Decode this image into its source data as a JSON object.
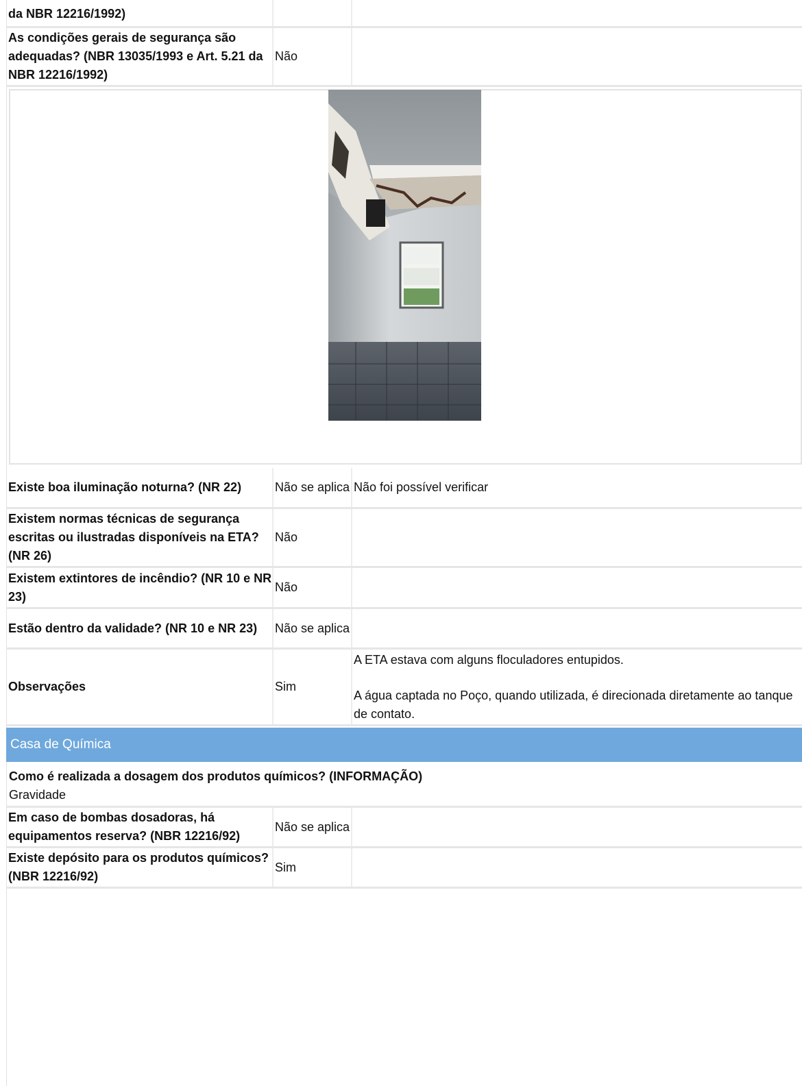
{
  "rows_top": [
    {
      "question": "da NBR 12216/1992)",
      "answer": "",
      "note": ""
    },
    {
      "question": "As condições gerais de segurança são adequadas? (NBR 13035/1993 e Art. 5.21 da NBR 12216/1992)",
      "answer": "Não",
      "note": ""
    }
  ],
  "rows_bottom": [
    {
      "question": "Existe boa iluminação noturna? (NR 22)",
      "answer": "Não se aplica",
      "note": "Não foi possível verificar"
    },
    {
      "question": "Existem normas técnicas de segurança escritas ou ilustradas disponíveis na ETA? (NR 26)",
      "answer": "Não",
      "note": ""
    },
    {
      "question": "Existem extintores de incêndio? (NR 10 e NR 23)",
      "answer": "Não",
      "note": ""
    },
    {
      "question": "Estão dentro da validade? (NR 10 e NR 23)",
      "answer": "Não se aplica",
      "note": ""
    },
    {
      "question": "Observações",
      "answer": "Sim",
      "note_lines": [
        "A ETA estava com alguns floculadores entupidos.",
        "A água captada no Poço, quando utilizada, é direcionada diretamente ao tanque de contato."
      ]
    }
  ],
  "section": {
    "title": "Casa de Química"
  },
  "info_row": {
    "question": "Como é realizada a dosagem dos produtos químicos? (INFORMAÇÃO)",
    "answer": "Gravidade"
  },
  "rows_chem": [
    {
      "question": "Em caso de bombas dosadoras, há equipamentos reserva? (NBR 12216/92)",
      "answer": "Não se aplica",
      "note": ""
    },
    {
      "question": "Existe depósito para os produtos químicos? (NBR 12216/92)",
      "answer": "Sim",
      "note": ""
    }
  ]
}
